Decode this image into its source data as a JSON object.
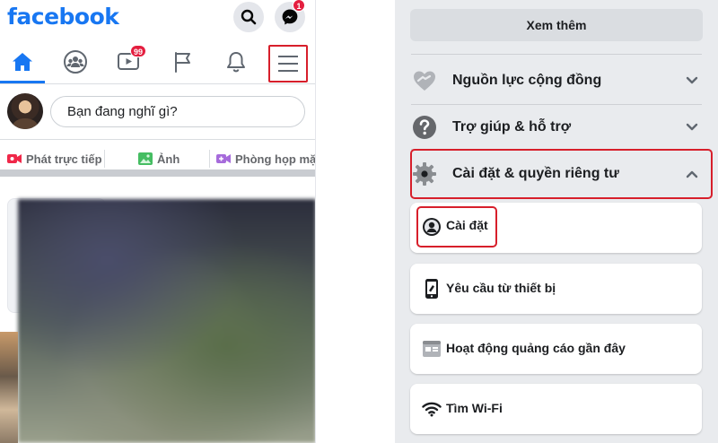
{
  "left_screen": {
    "logo": "facebook",
    "header_icons": [
      "search-icon",
      "messenger-icon"
    ],
    "messenger_badge": "1",
    "nav": {
      "tabs": [
        {
          "name": "home-icon",
          "active": true
        },
        {
          "name": "groups-icon",
          "active": false
        },
        {
          "name": "watch-icon",
          "active": false,
          "badge": "99"
        },
        {
          "name": "pages-flag-icon",
          "active": false
        },
        {
          "name": "notifications-bell-icon",
          "active": false
        },
        {
          "name": "menu-hamburger-icon",
          "active": false,
          "highlighted": true
        }
      ]
    },
    "composer": {
      "placeholder": "Bạn đang nghĩ gì?"
    },
    "actions": {
      "live": "Phát trực tiếp",
      "photo": "Ảnh",
      "room": "Phòng họp mặt"
    }
  },
  "right_screen": {
    "see_more": "Xem thêm",
    "sections": {
      "community": "Nguồn lực cộng đồng",
      "help": "Trợ giúp & hỗ trợ",
      "settings_privacy": "Cài đặt & quyền riêng tư"
    },
    "items": {
      "settings": "Cài đặt",
      "device_requests": "Yêu cầu từ thiết bị",
      "ad_activity": "Hoạt động quảng cáo gần đây",
      "find_wifi": "Tìm Wi-Fi"
    }
  },
  "colors": {
    "brand_blue": "#1877f2",
    "highlight_red": "#d71f2b",
    "badge_red": "#e41e3f",
    "live_red": "#f02849",
    "photo_green": "#45bd62",
    "room_purple": "#a66bdb"
  }
}
